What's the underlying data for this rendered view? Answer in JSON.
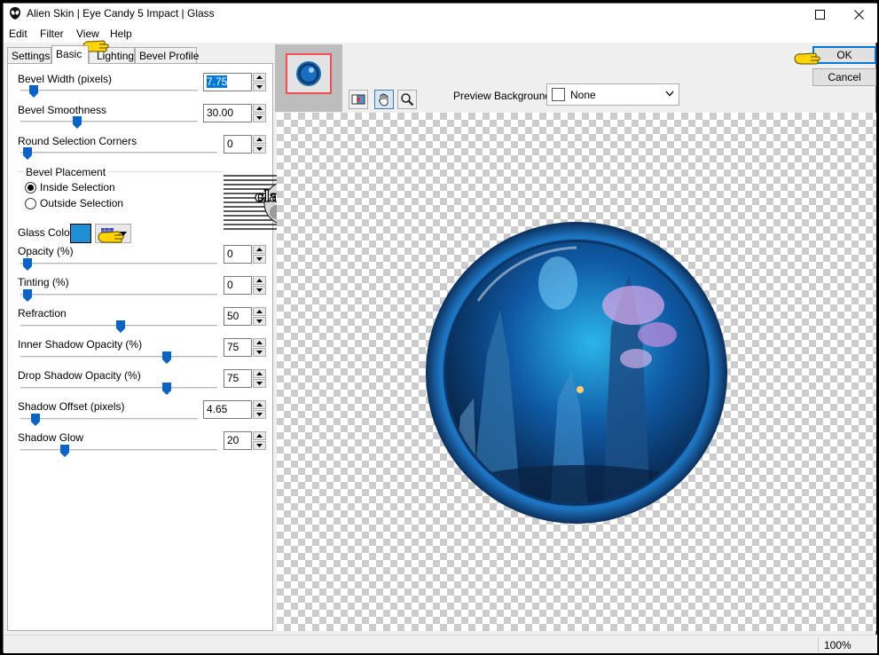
{
  "window": {
    "title": "Alien Skin | Eye Candy 5 Impact | Glass",
    "app_icon": "alien-skin-logo-icon"
  },
  "menu": [
    "Edit",
    "Filter",
    "View",
    "Help"
  ],
  "tabs": [
    "Settings",
    "Basic",
    "Lighting",
    "Bevel Profile"
  ],
  "active_tab": "Basic",
  "params": {
    "bevel_width": {
      "label": "Bevel Width (pixels)",
      "value": "7.75",
      "level": 0.08
    },
    "bevel_smoothness": {
      "label": "Bevel Smoothness",
      "value": "30.00",
      "level": 0.3
    },
    "round_corners": {
      "label": "Round Selection Corners",
      "value": "0",
      "level": 0.0
    },
    "opacity": {
      "label": "Opacity (%)",
      "value": "0",
      "level": 0.0
    },
    "tinting": {
      "label": "Tinting (%)",
      "value": "0",
      "level": 0.0
    },
    "refraction": {
      "label": "Refraction",
      "value": "50",
      "level": 0.5
    },
    "inner_shadow": {
      "label": "Inner Shadow Opacity (%)",
      "value": "75",
      "level": 0.75
    },
    "drop_shadow": {
      "label": "Drop Shadow Opacity (%)",
      "value": "75",
      "level": 0.75
    },
    "shadow_offset": {
      "label": "Shadow Offset (pixels)",
      "value": "4.65",
      "level": 0.06
    },
    "shadow_glow": {
      "label": "Shadow Glow",
      "value": "20",
      "level": 0.2
    }
  },
  "bevel_placement": {
    "label": "Bevel Placement",
    "options": [
      "Inside Selection",
      "Outside Selection"
    ],
    "selected": "Inside Selection"
  },
  "glass_color": {
    "label": "Glass Color",
    "color": "#1e8fd4"
  },
  "watermark": "claudia",
  "preview": {
    "background_label": "Preview Background:",
    "background_value": "None",
    "tools": [
      "preview-compare-icon",
      "hand-pan-icon",
      "magnifier-icon"
    ]
  },
  "buttons": {
    "ok": "OK",
    "cancel": "Cancel"
  },
  "status": {
    "zoom": "100%"
  },
  "colors": {
    "accent": "#0078d7",
    "slider": "#0a64c8",
    "pointer_hand": "#ffd400"
  }
}
